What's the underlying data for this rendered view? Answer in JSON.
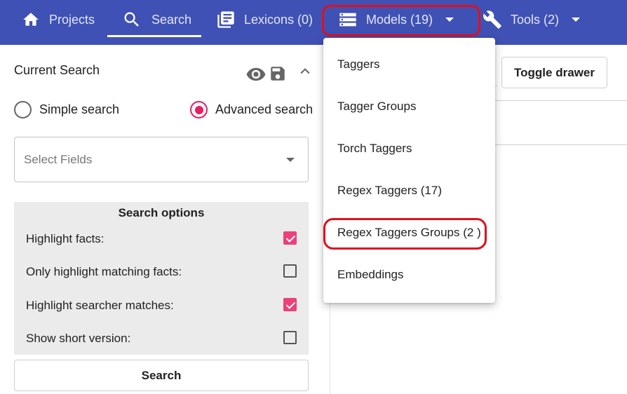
{
  "nav": {
    "projects": "Projects",
    "search": "Search",
    "lexicons": "Lexicons (0)",
    "models": "Models (19)",
    "tools": "Tools (2)",
    "icons": {
      "projects": "home-icon",
      "search": "search-icon",
      "lexicons": "library-books-icon",
      "models": "storage-icon",
      "tools": "wrench-icon"
    }
  },
  "sidebar": {
    "title": "Current Search",
    "radio_simple": "Simple search",
    "radio_advanced": "Advanced search",
    "selected_mode": "advanced",
    "select_fields_placeholder": "Select Fields",
    "options_title": "Search options",
    "options": [
      {
        "label": "Highlight facts:",
        "checked": true
      },
      {
        "label": "Only highlight matching facts:",
        "checked": false
      },
      {
        "label": "Highlight searcher matches:",
        "checked": true
      },
      {
        "label": "Show short version:",
        "checked": false
      }
    ],
    "search_button": "Search"
  },
  "main": {
    "toggle_drawer": "Toggle drawer"
  },
  "models_menu": {
    "items": [
      "Taggers",
      "Tagger Groups",
      "Torch Taggers",
      "Regex Taggers (17)",
      "Regex Taggers Groups (2 )",
      "Embeddings"
    ]
  },
  "colors": {
    "primary": "#3f51b5",
    "accent": "#e91e63",
    "annotation": "#e0101b"
  }
}
